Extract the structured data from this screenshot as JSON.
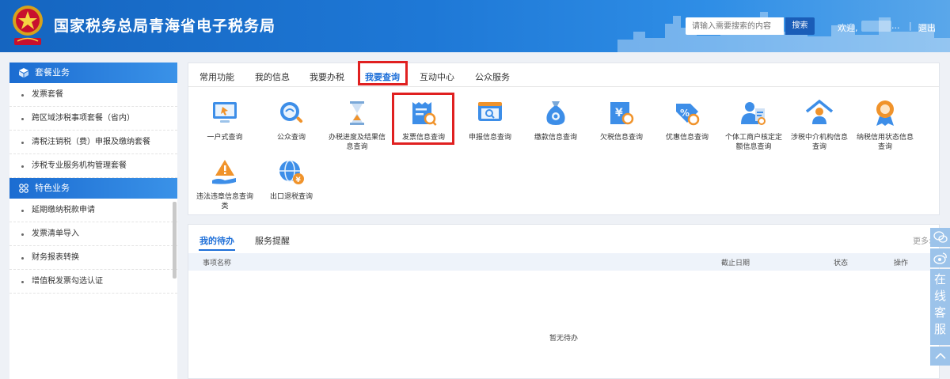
{
  "header": {
    "title": "国家税务总局青海省电子税务局",
    "search_placeholder": "请输入需要搜索的内容",
    "search_button": "搜索",
    "welcome": "欢迎,",
    "ellipsis": "...",
    "separator": "|",
    "logout": "退出"
  },
  "sidebar": {
    "section1": "套餐业务",
    "section1_items": [
      "发票套餐",
      "跨区域涉税事项套餐（省内）",
      "清税注销税（费）申报及缴纳套餐",
      "涉税专业服务机构管理套餐"
    ],
    "section2": "特色业务",
    "section2_items": [
      "延期缴纳税款申请",
      "发票清单导入",
      "财务报表转换",
      "增值税发票勾选认证"
    ]
  },
  "tabs": [
    "常用功能",
    "我的信息",
    "我要办税",
    "我要查询",
    "互动中心",
    "公众服务"
  ],
  "active_tab": "我要查询",
  "tiles": [
    {
      "label": "一户式查询",
      "icon": "monitor-icon"
    },
    {
      "label": "公众查询",
      "icon": "search-globe-icon"
    },
    {
      "label": "办税进度及结果信息查询",
      "icon": "hourglass-icon"
    },
    {
      "label": "发票信息查询",
      "icon": "invoice-search-icon"
    },
    {
      "label": "申报信息查询",
      "icon": "declaration-search-icon"
    },
    {
      "label": "缴款信息查询",
      "icon": "money-bag-icon"
    },
    {
      "label": "欠税信息查询",
      "icon": "yen-receipt-icon"
    },
    {
      "label": "优惠信息查询",
      "icon": "discount-icon"
    },
    {
      "label": "个体工商户核定定额信息查询",
      "icon": "person-doc-icon"
    },
    {
      "label": "涉税中介机构信息查询",
      "icon": "house-person-icon"
    },
    {
      "label": "纳税信用状态信息查询",
      "icon": "medal-icon"
    },
    {
      "label": "违法违章信息查询类",
      "icon": "warning-hand-icon"
    },
    {
      "label": "出口退税查询",
      "icon": "globe-yen-icon"
    }
  ],
  "todo": {
    "tab_mine": "我的待办",
    "tab_reminder": "服务提醒",
    "more": "更多>",
    "col_name": "事项名称",
    "col_deadline": "截止日期",
    "col_status": "状态",
    "col_action": "操作",
    "empty": "暂无待办"
  },
  "float": {
    "text": "在线客服"
  },
  "colors": {
    "header_blue": "#1e78d6",
    "active_blue": "#1e6fd8",
    "highlight_red": "#e02020"
  }
}
